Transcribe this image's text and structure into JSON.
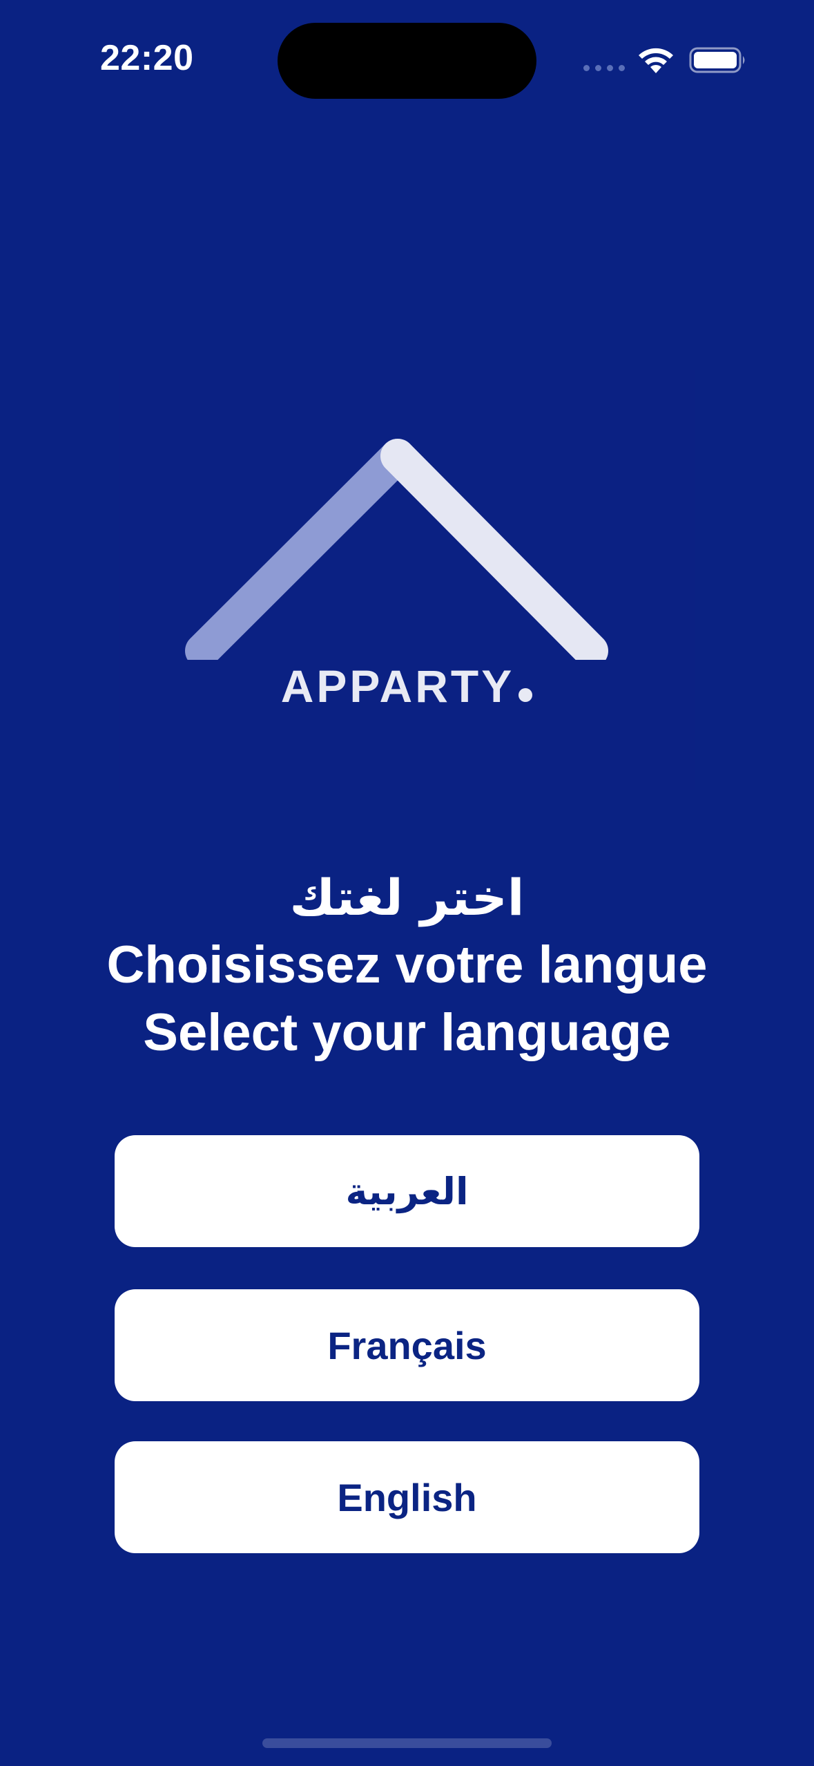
{
  "status_bar": {
    "time": "22:20"
  },
  "logo": {
    "wordmark": "APPARTY",
    "icon": "house-roof-icon"
  },
  "headings": {
    "arabic": "اختر لغتك",
    "french": "Choisissez votre langue",
    "english": "Select your language"
  },
  "languages": [
    {
      "label": "العربية"
    },
    {
      "label": "Français"
    },
    {
      "label": "English"
    }
  ],
  "colors": {
    "background": "#0a2283",
    "logo_box": "#0b2183",
    "button_bg": "#ffffff",
    "button_text": "#0b2483",
    "roof_left": "#8e9bd4",
    "roof_right": "#e5e7f3",
    "home_indicator": "#3a4d9c"
  }
}
